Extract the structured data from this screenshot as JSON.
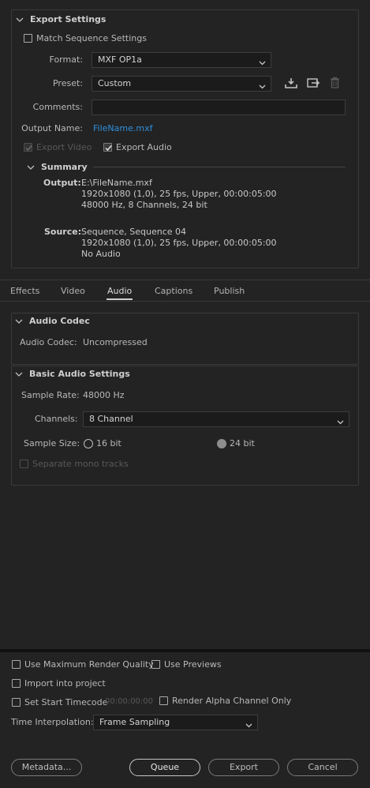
{
  "export_settings": {
    "title": "Export Settings",
    "match_sequence_label": "Match Sequence Settings",
    "format_label": "Format:",
    "format_value": "MXF OP1a",
    "preset_label": "Preset:",
    "preset_value": "Custom",
    "comments_label": "Comments:",
    "comments_value": "",
    "output_name_label": "Output Name:",
    "output_name_value": "FileName.mxf",
    "export_video_label": "Export Video",
    "export_audio_label": "Export Audio",
    "icons": [
      "save-preset-icon",
      "import-preset-icon",
      "delete-preset-icon"
    ]
  },
  "summary": {
    "title": "Summary",
    "output_key": "Output:",
    "output_lines": [
      "E:\\FileName.mxf",
      "1920x1080 (1,0), 25 fps, Upper, 00:00:05:00",
      "48000 Hz, 8 Channels, 24 bit"
    ],
    "source_key": "Source:",
    "source_lines": [
      "Sequence, Sequence 04",
      "1920x1080 (1,0), 25 fps, Upper, 00:00:05:00",
      "No Audio"
    ]
  },
  "tabs": [
    {
      "label": "Effects"
    },
    {
      "label": "Video"
    },
    {
      "label": "Audio"
    },
    {
      "label": "Captions"
    },
    {
      "label": "Publish"
    }
  ],
  "active_tab": "Audio",
  "audio_codec": {
    "title": "Audio Codec",
    "label": "Audio Codec:",
    "value": "Uncompressed"
  },
  "basic_audio": {
    "title": "Basic Audio Settings",
    "sample_rate_label": "Sample Rate:",
    "sample_rate_value": "48000 Hz",
    "channels_label": "Channels:",
    "channels_value": "8 Channel",
    "sample_size_label": "Sample Size:",
    "option_16": "16 bit",
    "option_24": "24 bit",
    "selected_sample_size": "24 bit",
    "separate_mono_label": "Separate mono tracks"
  },
  "bottom": {
    "max_quality_label": "Use Maximum Render Quality",
    "use_previews_label": "Use Previews",
    "import_label": "Import into project",
    "start_timecode_label": "Set Start Timecode",
    "start_timecode_value": "00:00:00:00",
    "alpha_label": "Render Alpha Channel Only",
    "time_interp_label": "Time Interpolation:",
    "time_interp_value": "Frame Sampling"
  },
  "buttons": {
    "metadata": "Metadata...",
    "queue": "Queue",
    "export": "Export",
    "cancel": "Cancel"
  },
  "colors": {
    "background": "#232323",
    "link": "#2f8fdc",
    "panel_border": "#3a3a3a"
  }
}
